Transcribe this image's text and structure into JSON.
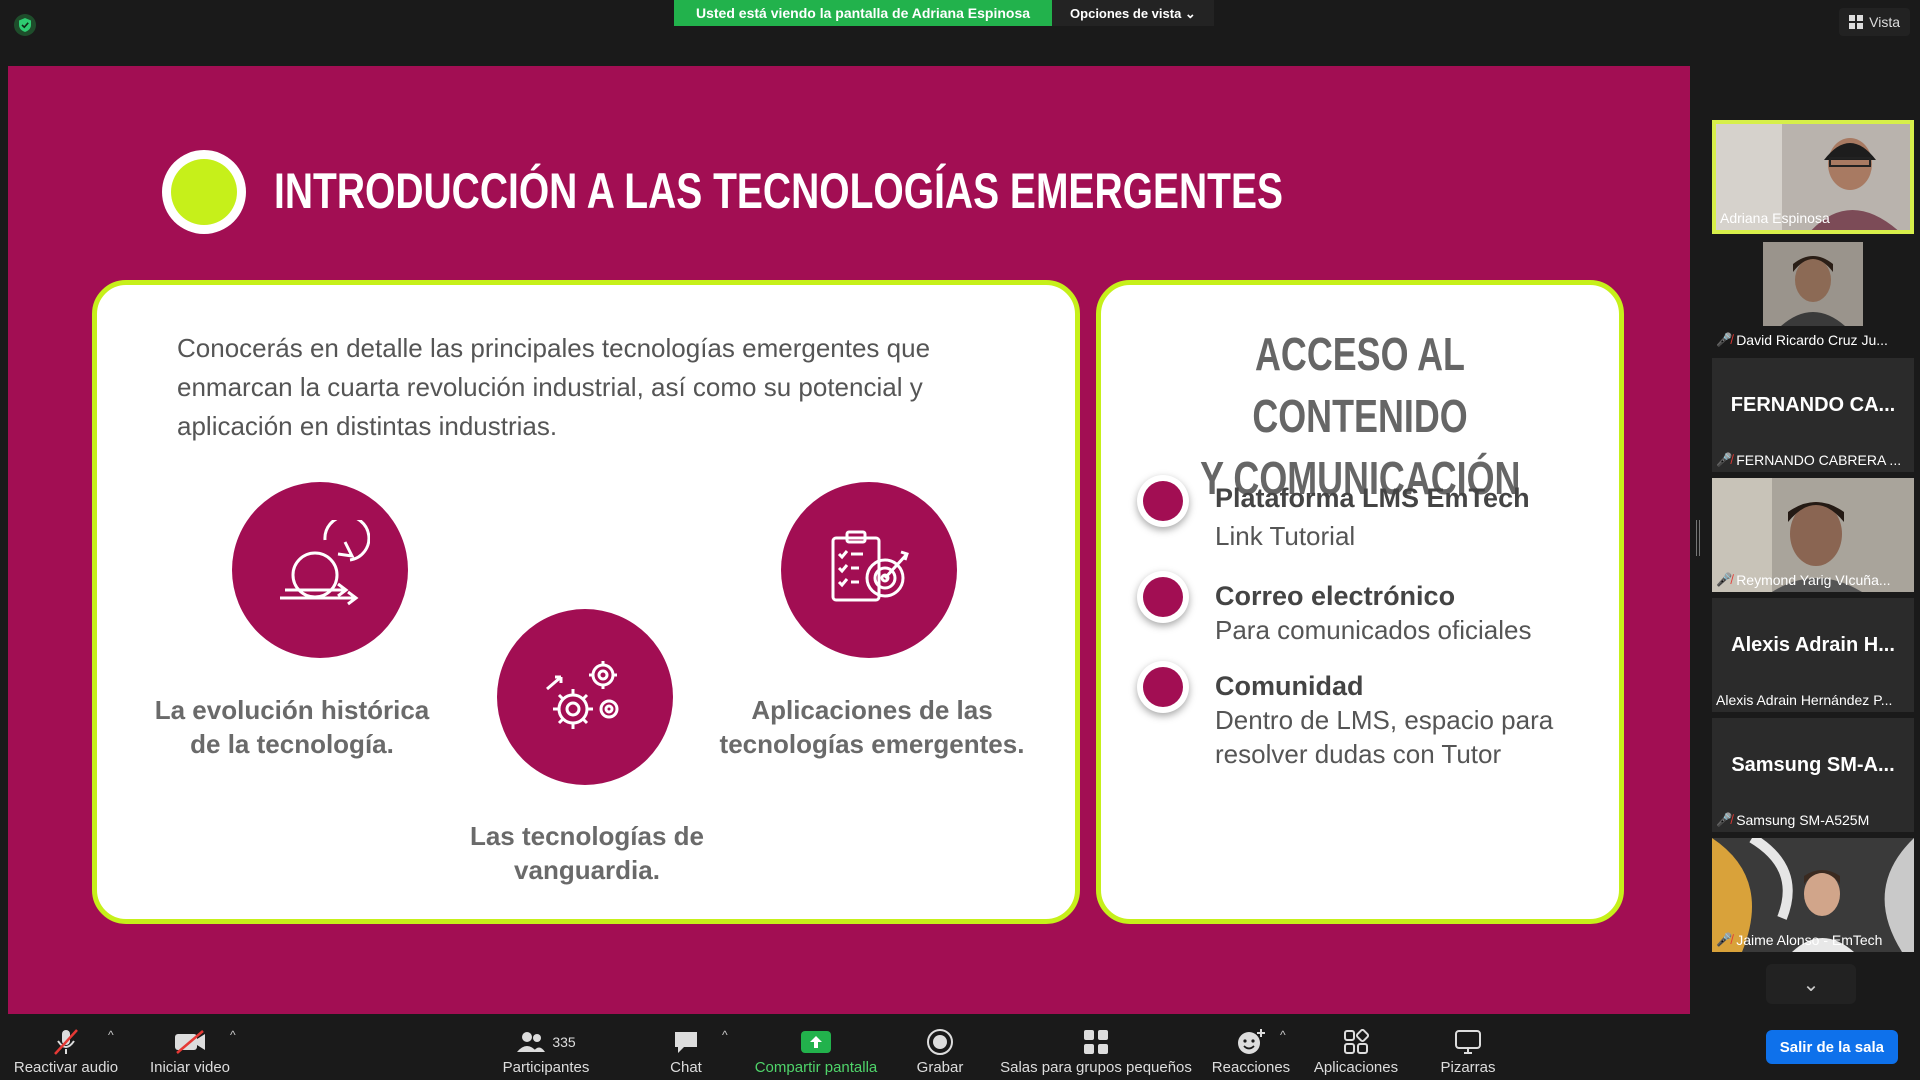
{
  "top": {
    "sharing_banner": "Usted está viendo la pantalla de Adriana Espinosa",
    "view_options": "Opciones de vista",
    "view_button": "Vista"
  },
  "slide": {
    "title": "INTRODUCCIÓN A LAS TECNOLOGÍAS EMERGENTES",
    "intro": "Conocerás en detalle las principales tecnologías emergentes que enmarcan la cuarta revolución industrial, así como su potencial y aplicación en distintas industrias.",
    "topics": [
      {
        "caption": "La evolución histórica de la tecnología.",
        "icon": "cycle-arrows-icon"
      },
      {
        "caption": "Las tecnologías de vanguardia.",
        "icon": "gears-icon"
      },
      {
        "caption": "Aplicaciones de las tecnologías emergentes.",
        "icon": "checklist-target-icon"
      }
    ],
    "access_title_line1": "ACCESO AL CONTENIDO",
    "access_title_line2": "Y COMUNICACIÓN",
    "access_items": [
      {
        "heading": "Plataforma LMS EmTech",
        "sub": "Link Tutorial"
      },
      {
        "heading": "Correo electrónico",
        "sub": "Para comunicados oficiales"
      },
      {
        "heading": "Comunidad",
        "sub": "Dentro de LMS, espacio para resolver dudas con Tutor"
      }
    ],
    "colors": {
      "background": "#a20e53",
      "accent": "#c6f01a"
    }
  },
  "participants": [
    {
      "name": "Adriana Espinosa",
      "video": true,
      "active": true,
      "muted": false
    },
    {
      "name": "David Ricardo Cruz Ju...",
      "video": true,
      "active": false,
      "muted": true
    },
    {
      "display": "FERNANDO CA...",
      "name": "FERNANDO CABRERA ...",
      "video": false,
      "muted": true
    },
    {
      "name": "Reymond Yarig VIcuña...",
      "video": true,
      "active": false,
      "muted": true
    },
    {
      "display": "Alexis Adrain H...",
      "name": "Alexis Adrain Hernández P...",
      "video": false,
      "muted": false
    },
    {
      "display": "Samsung SM-A...",
      "name": "Samsung SM-A525M",
      "video": false,
      "muted": true
    },
    {
      "name": "Jaime Alonso - EmTech",
      "video": true,
      "active": false,
      "muted": true
    }
  ],
  "toolbar": {
    "unmute": "Reactivar audio",
    "start_video": "Iniciar video",
    "participants": "Participantes",
    "participant_count": "335",
    "chat": "Chat",
    "share": "Compartir pantalla",
    "record": "Grabar",
    "breakout": "Salas para grupos pequeños",
    "reactions": "Reacciones",
    "apps": "Aplicaciones",
    "whiteboards": "Pizarras",
    "leave": "Salir de la sala"
  }
}
